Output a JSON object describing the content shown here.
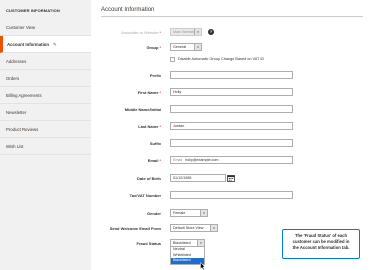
{
  "sidebar": {
    "title": "CUSTOMER INFORMATION",
    "items": [
      {
        "label": "Customer View"
      },
      {
        "label": "Account Information",
        "active": true
      },
      {
        "label": "Addresses"
      },
      {
        "label": "Orders"
      },
      {
        "label": "Billing Agreements"
      },
      {
        "label": "Newsletter"
      },
      {
        "label": "Product Reviews"
      },
      {
        "label": "Wish List"
      }
    ]
  },
  "main": {
    "title": "Account Information"
  },
  "form": {
    "website_label": "Associate to Website",
    "website_value": "Main Website",
    "group_label": "Group",
    "group_value": "General",
    "disable_auto_group_label": "Disable Automatic Group Change Based on VAT ID",
    "prefix_label": "Prefix",
    "prefix_value": "",
    "first_name_label": "First Name",
    "first_name_value": "Holly",
    "middle_name_label": "Middle Name/Initial",
    "middle_name_value": "",
    "last_name_label": "Last Name",
    "last_name_value": "Jordan",
    "suffix_label": "Suffix",
    "suffix_value": "",
    "email_label": "Email",
    "email_prefix": "Email",
    "email_value": "holly@example.com",
    "dob_label": "Date of Birth",
    "dob_value": "01/12/1985",
    "tax_label": "Tax/VAT Number",
    "tax_value": "",
    "gender_label": "Gender",
    "gender_value": "Female",
    "welcome_email_label": "Send Welcome Email From",
    "welcome_email_value": "Default Store View",
    "fraud_label": "Fraud Status",
    "fraud_value": "Blacklisted",
    "fraud_options": [
      "Neutral",
      "Whitelisted",
      "Blacklisted"
    ],
    "fraud_highlight": "Blacklisted"
  },
  "callout": {
    "lines": [
      "The 'Fraud Status' of each",
      "customer can be modified in",
      "the Account Information tab."
    ]
  },
  "colors": {
    "accent": "#eb5202",
    "required": "#e22626",
    "callout_border": "#007bdb",
    "highlight": "#1e6ed0"
  }
}
